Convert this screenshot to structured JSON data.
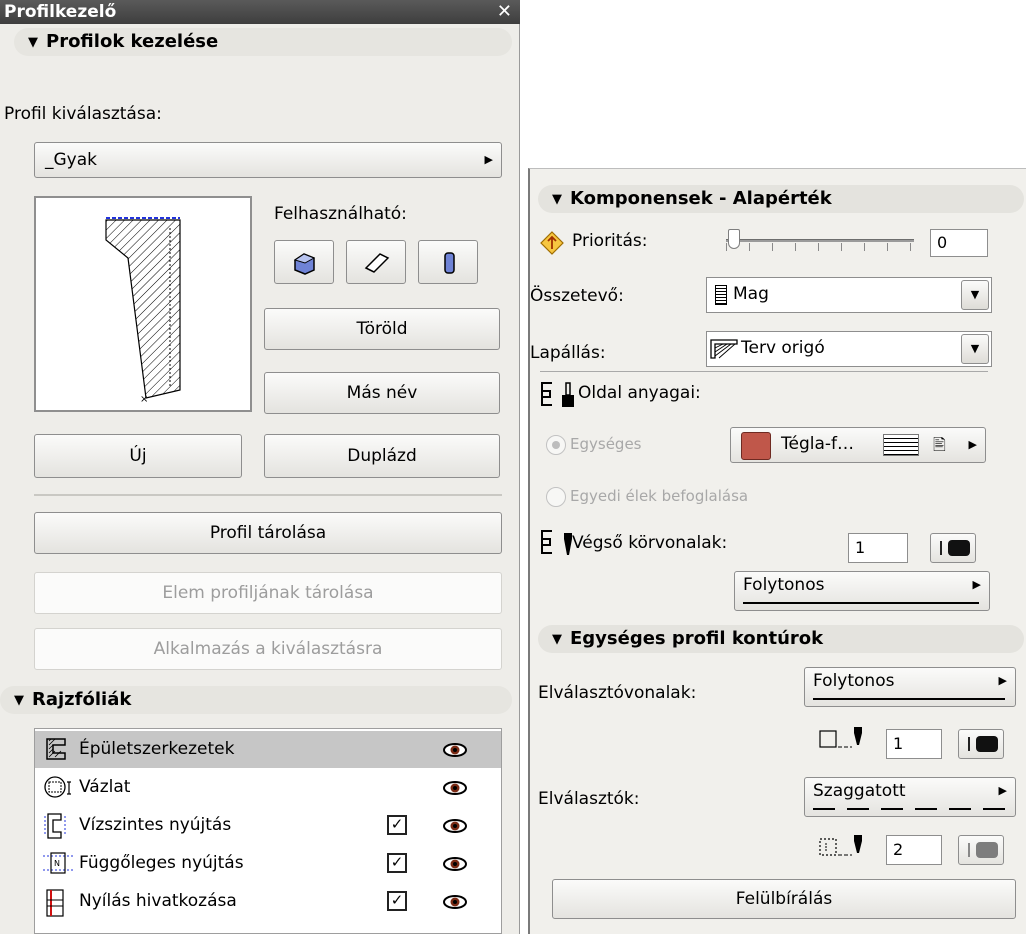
{
  "left_panel": {
    "title": "Profilkezelő",
    "close_glyph": "✕",
    "manage_section": {
      "header": "Profilok kezelése",
      "select_label": "Profil kiválasztása:",
      "selected_profile": "_Gyak",
      "usable_label": "Felhasználható:",
      "usable_icons": [
        "wall-icon",
        "beam-icon",
        "column-icon"
      ],
      "delete_button": "Töröld",
      "rename_button": "Más név",
      "new_button": "Új",
      "duplicate_button": "Duplázd",
      "store_profile_button": "Profil tárolása",
      "store_element_profile_button": "Elem profiljának tárolása",
      "apply_to_selection_button": "Alkalmazás a kiválasztásra"
    },
    "layers_section": {
      "header": "Rajzfóliák",
      "items": [
        {
          "label": "Épületszerkezetek",
          "icon": "structure-layer-icon",
          "has_checkbox": false,
          "checked": false,
          "visible": true
        },
        {
          "label": "Vázlat",
          "icon": "sketch-layer-icon",
          "has_checkbox": false,
          "checked": false,
          "visible": true
        },
        {
          "label": "Vízszintes nyújtás",
          "icon": "horizontal-stretch-icon",
          "has_checkbox": true,
          "checked": true,
          "visible": true
        },
        {
          "label": "Függőleges nyújtás",
          "icon": "vertical-stretch-icon",
          "has_checkbox": true,
          "checked": true,
          "visible": true
        },
        {
          "label": "Nyílás hivatkozása",
          "icon": "opening-reference-icon",
          "has_checkbox": true,
          "checked": true,
          "visible": true
        }
      ]
    }
  },
  "right_panel": {
    "components_section": {
      "header": "Komponensek - Alapérték",
      "priority_label": "Prioritás:",
      "priority_value": "0",
      "component_label": "Összetevő:",
      "component_value": "Mag",
      "hatch_label": "Lapállás:",
      "hatch_value": "Terv origó",
      "side_materials_label": "Oldal anyagai:",
      "uniform_radio_label": "Egységes",
      "edges_radio_label": "Egyedi élek befoglalása",
      "material_value": "Tégla-f…",
      "material_color": "#c0574a",
      "end_contours_label": "Végső körvonalak:",
      "end_contour_pen": "1",
      "end_contour_line": "Folytonos"
    },
    "contours_section": {
      "header": "Egységes profil kontúrok",
      "separator_lines_label": "Elválasztóvonalak:",
      "separator_lines_value": "Folytonos",
      "separator_lines_pen": "1",
      "separators_label": "Elválasztók:",
      "separators_value": "Szaggatott",
      "separators_pen": "2",
      "override_button": "Felülbírálás"
    }
  }
}
